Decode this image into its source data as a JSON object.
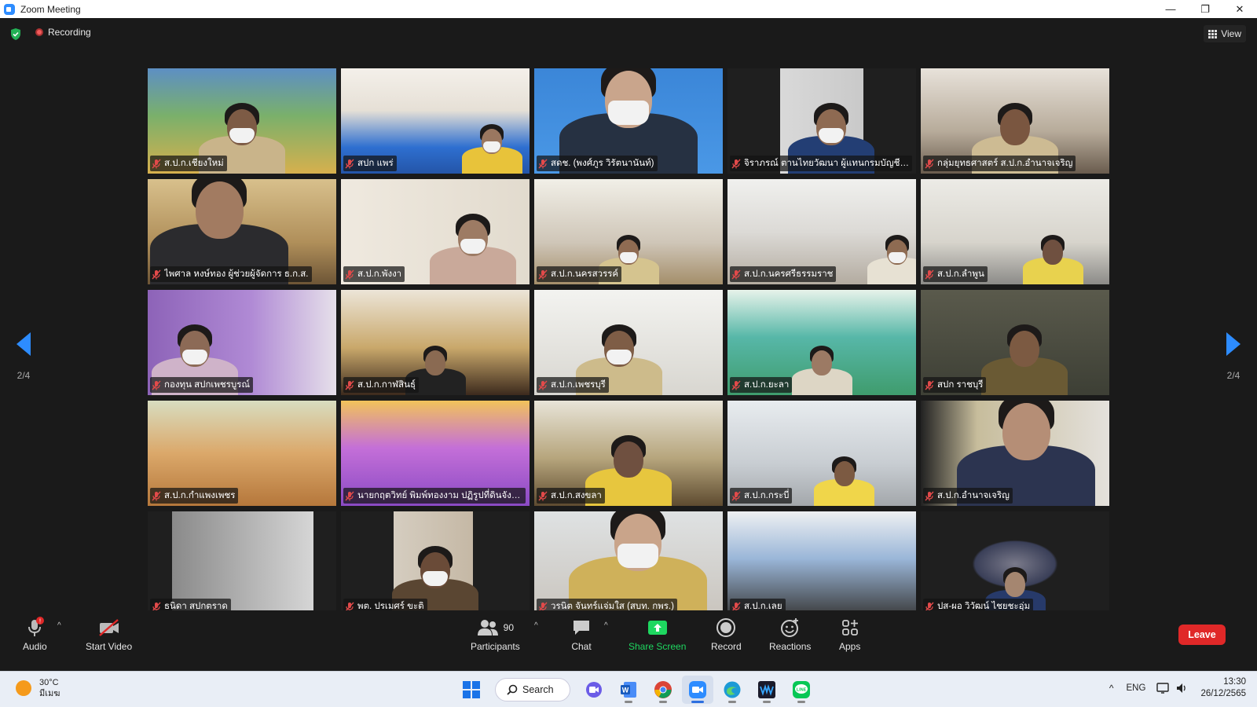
{
  "window": {
    "title": "Zoom Meeting",
    "minimize": "—",
    "restore": "❐",
    "close": "✕"
  },
  "topbar": {
    "recording_label": "Recording",
    "view_label": "View"
  },
  "pager": {
    "left": "2/4",
    "right": "2/4"
  },
  "participants": [
    {
      "name": "ส.ป.ก.เชียงใหม่"
    },
    {
      "name": "สปก แพร่"
    },
    {
      "name": "สดช. (พงศ์ภูร วิรัตนานันท์)"
    },
    {
      "name": "จิราภรณ์ ตานไทยวัฒนา ผู้แทนกรมบัญชีก..."
    },
    {
      "name": "กลุ่มยุทธศาสตร์ ส.ป.ก.อำนาจเจริญ"
    },
    {
      "name": "ไพศาล หงษ์ทอง ผู้ช่วยผู้จัดการ ธ.ก.ส."
    },
    {
      "name": "ส.ป.ก.พังงา"
    },
    {
      "name": "ส.ป.ก.นครสวรรค์"
    },
    {
      "name": "ส.ป.ก.นครศรีธรรมราช"
    },
    {
      "name": "ส.ป.ก.ลำพูน"
    },
    {
      "name": "กองทุน สปกเพชรบูรณ์"
    },
    {
      "name": "ส.ป.ก.กาฬสินธุ์"
    },
    {
      "name": "ส.ป.ก.เพชรบุรี"
    },
    {
      "name": "ส.ป.ก.ยะลา"
    },
    {
      "name": "สปก ราชบุรี"
    },
    {
      "name": "ส.ป.ก.กำแพงเพชร"
    },
    {
      "name": "นายกฤตวิทย์ พิมพ์ทองงาม ปฏิรูปที่ดินจังหวัด..."
    },
    {
      "name": "ส.ป.ก.สงขลา"
    },
    {
      "name": "ส.ป.ก.กระบี่"
    },
    {
      "name": "ส.ป.ก.อำนาจเจริญ"
    },
    {
      "name": "ธนิดา สปกตราด"
    },
    {
      "name": "พต. ปรเมศร์ ขะติ"
    },
    {
      "name": "วรนิต จันทร์แจ่มใส (สบท. กพร.)"
    },
    {
      "name": "ส.ป.ก.เลย"
    },
    {
      "name": "ปส-ผอ วิวัฒน์ ไชยชะอุ่ม"
    }
  ],
  "toolbar": {
    "audio": "Audio",
    "start_video": "Start Video",
    "participants_count": "90",
    "participants": "Participants",
    "chat": "Chat",
    "share_screen": "Share Screen",
    "record": "Record",
    "reactions": "Reactions",
    "apps": "Apps",
    "leave": "Leave",
    "caret": "^"
  },
  "taskbar": {
    "weather_temp": "30°C",
    "weather_desc": "มีเมฆ",
    "search": "Search",
    "lang": "ENG",
    "time": "13:30",
    "date": "26/12/2565",
    "tray_caret": "^"
  },
  "colors": {
    "accent": "#2d8cff",
    "leave": "#e02828",
    "share": "#1ed760"
  }
}
